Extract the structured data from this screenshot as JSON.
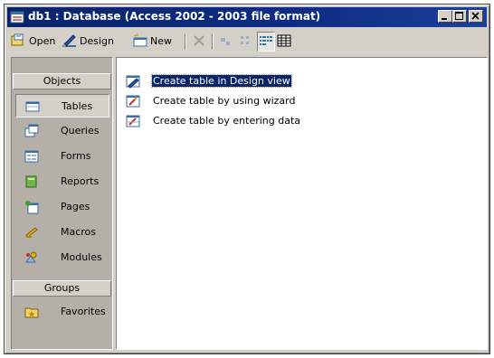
{
  "window": {
    "title": "db1 : Database (Access 2002 - 2003 file format)"
  },
  "toolbar": {
    "open_label": "Open",
    "design_label": "Design",
    "new_label": "New"
  },
  "sidebar": {
    "objects_header": "Objects",
    "items": [
      {
        "label": "Tables",
        "icon": "table-icon",
        "selected": true
      },
      {
        "label": "Queries",
        "icon": "query-icon"
      },
      {
        "label": "Forms",
        "icon": "form-icon"
      },
      {
        "label": "Reports",
        "icon": "report-icon"
      },
      {
        "label": "Pages",
        "icon": "page-icon"
      },
      {
        "label": "Macros",
        "icon": "macro-icon"
      },
      {
        "label": "Modules",
        "icon": "module-icon"
      }
    ],
    "groups_header": "Groups",
    "groups": [
      {
        "label": "Favorites",
        "icon": "favorites-folder-icon"
      }
    ]
  },
  "main": {
    "items": [
      {
        "label": "Create table in Design view",
        "selected": true,
        "icon": "table-design-icon"
      },
      {
        "label": "Create table by using wizard",
        "icon": "table-wizard-icon"
      },
      {
        "label": "Create table by entering data",
        "icon": "table-entry-icon"
      }
    ]
  }
}
